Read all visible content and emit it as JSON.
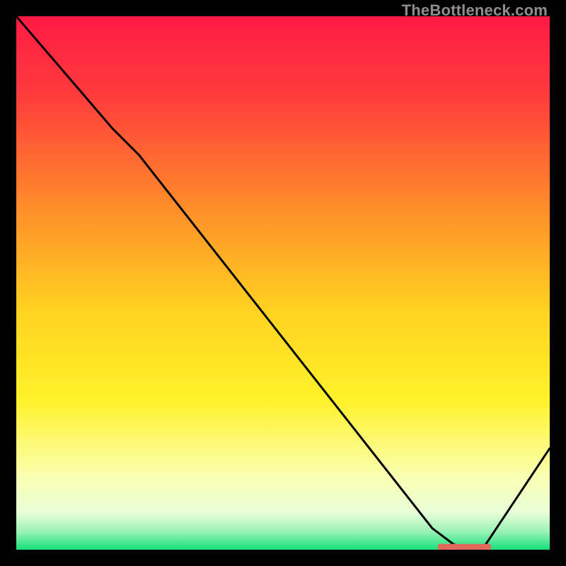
{
  "watermark": "TheBottleneck.com",
  "chart_data": {
    "type": "line",
    "title": "",
    "xlabel": "",
    "ylabel": "",
    "xlim": [
      0,
      100
    ],
    "ylim": [
      0,
      100
    ],
    "grid": false,
    "background_gradient": {
      "stops": [
        {
          "pos": 0.0,
          "color": "#ff1a44"
        },
        {
          "pos": 0.15,
          "color": "#ff3c3c"
        },
        {
          "pos": 0.35,
          "color": "#ff8a2a"
        },
        {
          "pos": 0.55,
          "color": "#ffd21f"
        },
        {
          "pos": 0.72,
          "color": "#fff22a"
        },
        {
          "pos": 0.86,
          "color": "#fbffb0"
        },
        {
          "pos": 0.93,
          "color": "#e8ffd8"
        },
        {
          "pos": 0.965,
          "color": "#9df2b8"
        },
        {
          "pos": 1.0,
          "color": "#16e07a"
        }
      ]
    },
    "series": [
      {
        "name": "curve",
        "stroke": "#000000",
        "x": [
          0,
          18,
          23,
          78,
          82,
          86,
          88,
          100
        ],
        "values": [
          100,
          79,
          74,
          4,
          1,
          0,
          1,
          19
        ]
      }
    ],
    "marker": {
      "name": "highlight-bar",
      "color": "#e06a5a",
      "x_start": 79,
      "x_end": 89,
      "y": 0.5,
      "thickness": 1.2
    }
  }
}
